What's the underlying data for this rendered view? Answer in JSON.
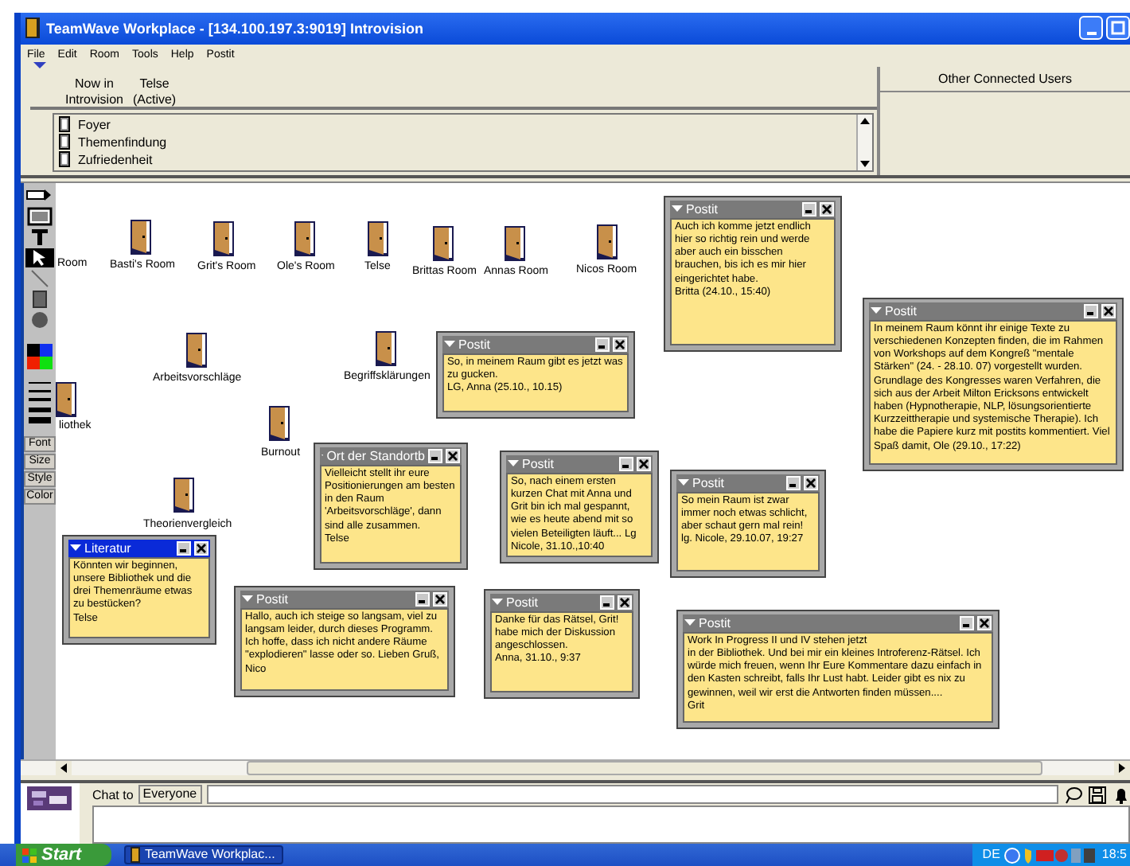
{
  "window": {
    "title": "TeamWave Workplace - [134.100.197.3:9019] Introvision"
  },
  "menu": [
    "File",
    "Edit",
    "Room",
    "Tools",
    "Help",
    "Postit"
  ],
  "presence": {
    "location": "Now in\nIntrovision",
    "users": [
      {
        "name": "Telse",
        "status": "(Active)"
      }
    ]
  },
  "room_list": [
    {
      "name": "Foyer"
    },
    {
      "name": "Themenfindung"
    },
    {
      "name": "Zufriedenheit"
    }
  ],
  "other_users": {
    "title": "Other Connected Users"
  },
  "tools": [
    {
      "kind": "connector",
      "selected": false
    },
    {
      "kind": "frame",
      "selected": false
    },
    {
      "kind": "text",
      "selected": false
    },
    {
      "kind": "select",
      "selected": true
    },
    {
      "kind": "line",
      "selected": false
    },
    {
      "kind": "rect",
      "selected": false
    },
    {
      "kind": "oval",
      "selected": false
    }
  ],
  "format_buttons": [
    "Font",
    "Size",
    "Style",
    "Color"
  ],
  "rooms": [
    {
      "name": "Room"
    },
    {
      "name": "Basti's Room"
    },
    {
      "name": "Grit's Room"
    },
    {
      "name": "Ole's Room"
    },
    {
      "name": "Telse"
    },
    {
      "name": "Brittas Room"
    },
    {
      "name": "Annas Room"
    },
    {
      "name": "Nicos Room"
    },
    {
      "name": "Arbeitsvorschläge"
    },
    {
      "name": "Begriffsklärungen"
    },
    {
      "name": "liothek"
    },
    {
      "name": "Burnout"
    },
    {
      "name": "Theorienvergleich"
    }
  ],
  "postits": [
    {
      "title": "Postit",
      "active": false,
      "text": "Auch ich komme jetzt endlich hier so richtig rein und werde aber auch ein bisschen brauchen, bis ich es mir hier eingerichtet habe.\nBritta (24.10., 15:40)"
    },
    {
      "title": "Postit",
      "active": false,
      "text": "So, in meinem Raum gibt es jetzt was zu gucken.\nLG, Anna (25.10., 10.15)"
    },
    {
      "title": "Postit",
      "active": false,
      "text": "In meinem Raum könnt ihr einige Texte zu verschiedenen Konzepten finden, die im Rahmen von Workshops auf dem Kongreß \"mentale Stärken\" (24. - 28.10. 07) vorgestellt wurden. Grundlage des Kongresses waren Verfahren, die sich aus der Arbeit Milton Ericksons entwickelt haben (Hypnotherapie, NLP, lösungsorientierte Kurzzeittherapie und systemische Therapie). Ich habe die Papiere kurz mit postits kommentiert. Viel Spaß damit, Ole (29.10., 17:22)"
    },
    {
      "title": "Ort der Standortb",
      "active": false,
      "text": "Vielleicht stellt ihr eure Positionierungen am besten in den Raum 'Arbeitsvorschläge', dann sind alle zusammen.\nTelse"
    },
    {
      "title": "Postit",
      "active": false,
      "text": "So, nach einem ersten kurzen Chat mit Anna und Grit bin ich mal gespannt, wie es heute abend mit so vielen Beteiligten läuft... Lg Nicole, 31.10.,10:40"
    },
    {
      "title": "Postit",
      "active": false,
      "text": "So mein Raum ist zwar immer noch etwas schlicht, aber schaut gern mal rein! lg. Nicole, 29.10.07, 19:27"
    },
    {
      "title": "Literatur",
      "active": true,
      "text": "Könnten wir beginnen, unsere Bibliothek und die drei Themenräume etwas zu bestücken?\nTelse"
    },
    {
      "title": "Postit",
      "active": false,
      "text": "Hallo, auch ich steige so langsam, viel zu langsam leider, durch dieses Programm. Ich hoffe, dass ich nicht andere Räume \"explodieren\" lasse oder so. Lieben Gruß, Nico"
    },
    {
      "title": "Postit",
      "active": false,
      "text": "Danke für das Rätsel, Grit! habe mich der Diskussion angeschlossen.\nAnna, 31.10., 9:37"
    },
    {
      "title": "Postit",
      "active": false,
      "text": "Work In Progress II und IV stehen jetzt\nin der Bibliothek. Und bei mir ein kleines Introferenz-Rätsel. Ich würde mich freuen, wenn Ihr Eure Kommentare dazu einfach in den Kasten schreibt, falls Ihr Lust habt. Leider gibt es nix zu gewinnen, weil wir erst die Antworten finden müssen....\nGrit"
    }
  ],
  "chat": {
    "label": "Chat to",
    "recipient": "Everyone"
  },
  "taskbar": {
    "start": "Start",
    "task": "TeamWave Workplac...",
    "language": "DE",
    "clock": "18:5"
  }
}
